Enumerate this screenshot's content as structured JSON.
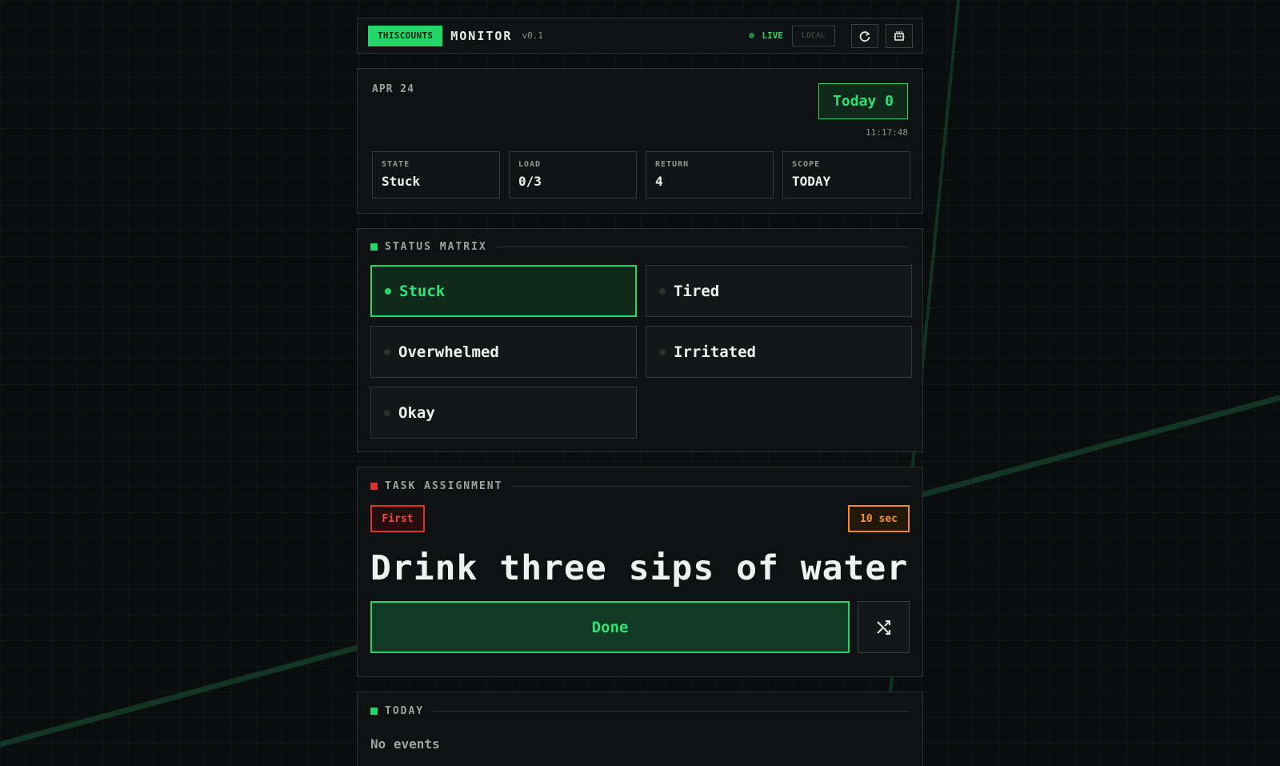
{
  "header": {
    "brand": "THISCOUNTS",
    "app_name": "MONITOR",
    "version": "v0.1",
    "live_label": "LIVE",
    "local_label": "LOCAL",
    "icons": [
      "refresh-icon",
      "robot-icon"
    ]
  },
  "summary": {
    "date": "APR 24",
    "today_badge": "Today 0",
    "time": "11:17:48",
    "stats": [
      {
        "label": "STATE",
        "value": "Stuck"
      },
      {
        "label": "LOAD",
        "value": "0/3"
      },
      {
        "label": "RETURN",
        "value": "4"
      },
      {
        "label": "SCOPE",
        "value": "TODAY"
      }
    ]
  },
  "status_matrix": {
    "title": "STATUS MATRIX",
    "items": [
      {
        "label": "Stuck",
        "active": true
      },
      {
        "label": "Tired",
        "active": false
      },
      {
        "label": "Overwhelmed",
        "active": false
      },
      {
        "label": "Irritated",
        "active": false
      },
      {
        "label": "Okay",
        "active": false
      }
    ]
  },
  "task": {
    "title": "TASK ASSIGNMENT",
    "tag": "First",
    "duration": "10 sec",
    "text": "Drink three sips of water",
    "done_label": "Done",
    "shuffle_icon": "shuffle-icon"
  },
  "today": {
    "title": "TODAY",
    "empty_text": "No events"
  },
  "colors": {
    "accent": "#22d66a",
    "danger": "#e0322d",
    "warning": "#f08a24",
    "background": "#0a0d0d"
  }
}
